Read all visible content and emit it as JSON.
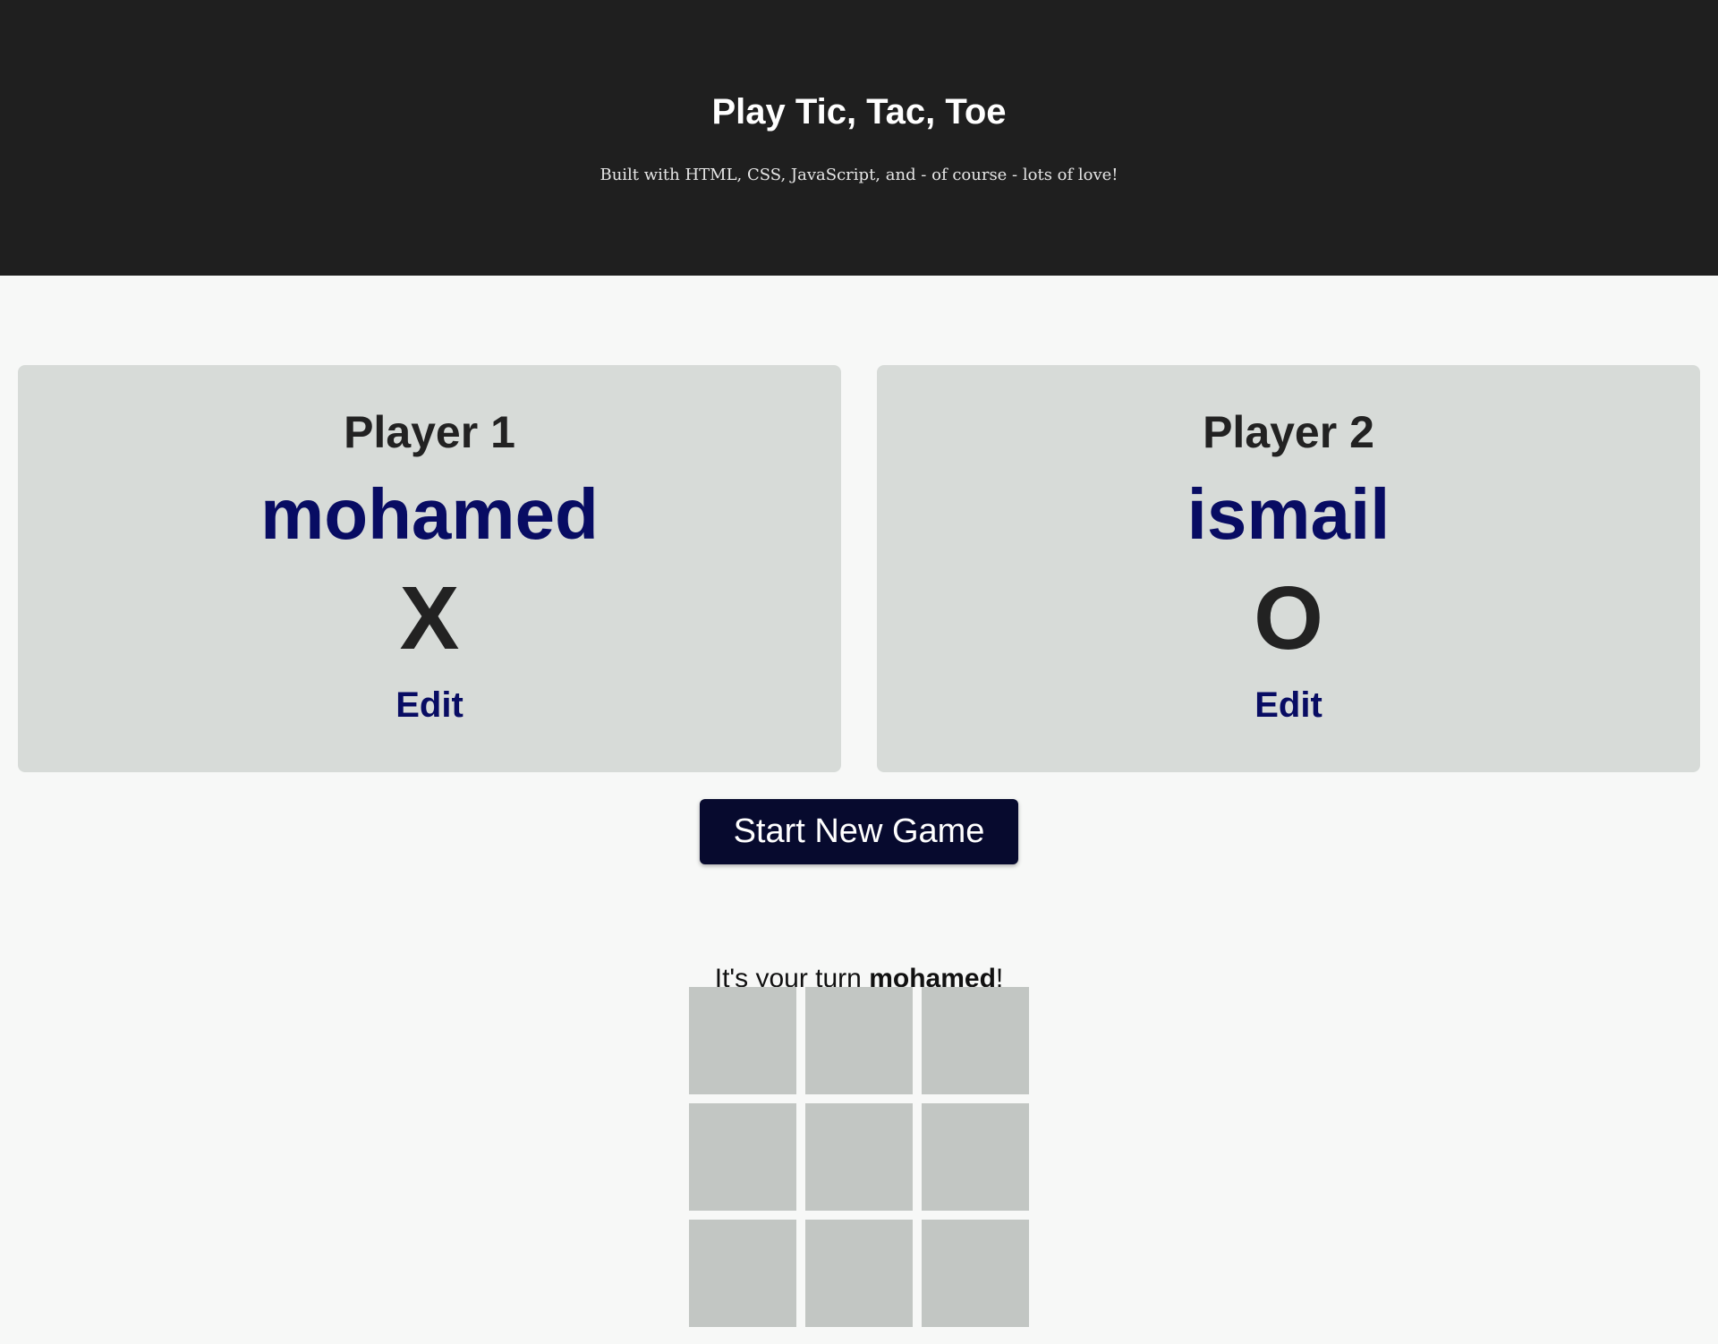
{
  "header": {
    "title": "Play Tic, Tac, Toe",
    "subtitle": "Built with HTML, CSS, JavaScript, and - of course - lots of love!"
  },
  "players": [
    {
      "label": "Player 1",
      "name": "mohamed",
      "symbol": "X",
      "edit_label": "Edit"
    },
    {
      "label": "Player 2",
      "name": "ismail",
      "symbol": "O",
      "edit_label": "Edit"
    }
  ],
  "controls": {
    "start_label": "Start New Game"
  },
  "turn": {
    "prefix": "It's your turn ",
    "player": "mohamed",
    "suffix": "!"
  },
  "board": {
    "cells": [
      "",
      "",
      "",
      "",
      "",
      "",
      "",
      "",
      ""
    ]
  },
  "colors": {
    "header_bg": "#1f1f1f",
    "card_bg": "#d7dbd8",
    "accent": "#080c63",
    "button_bg": "#070a2e",
    "cell_bg": "#c2c6c3"
  }
}
